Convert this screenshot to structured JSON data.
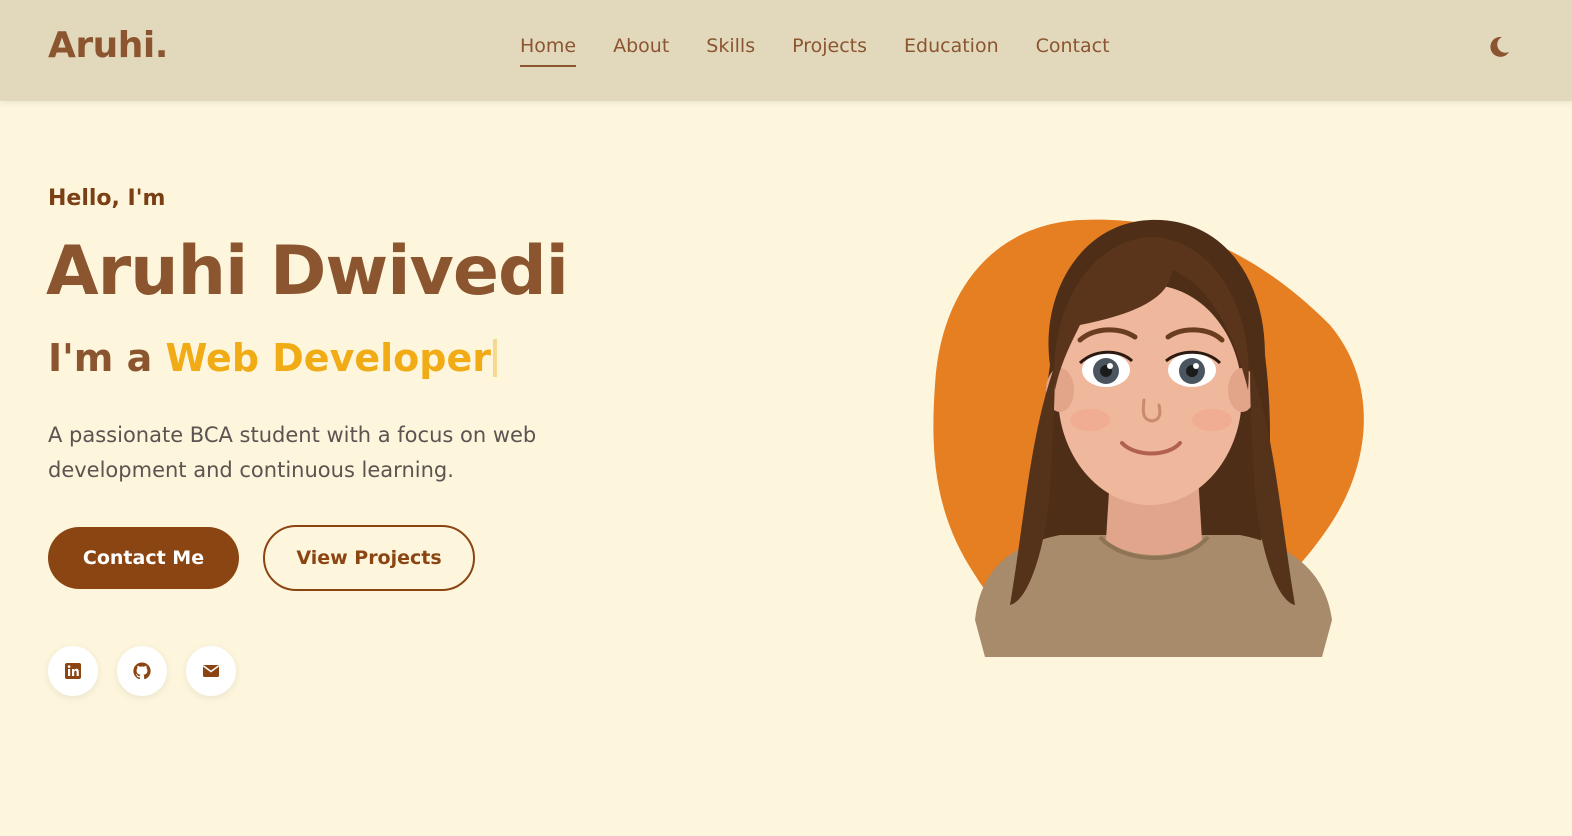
{
  "header": {
    "logo": "Aruhi.",
    "nav": [
      {
        "label": "Home",
        "active": true
      },
      {
        "label": "About",
        "active": false
      },
      {
        "label": "Skills",
        "active": false
      },
      {
        "label": "Projects",
        "active": false
      },
      {
        "label": "Education",
        "active": false
      },
      {
        "label": "Contact",
        "active": false
      }
    ],
    "theme_toggle_icon": "moon-icon"
  },
  "hero": {
    "greeting": "Hello, I'm",
    "name": "Aruhi Dwivedi",
    "role_prefix": "I'm a ",
    "role_text": "Web Developer",
    "description": "A passionate BCA student with a focus on web development and continuous learning.",
    "primary_button": "Contact Me",
    "secondary_button": "View Projects",
    "social_icons": [
      "linkedin-icon",
      "github-icon",
      "envelope-icon"
    ]
  },
  "colors": {
    "page_bg": "#fdf6dd",
    "header_bg": "#e2d9bd",
    "brand_brown": "#8b5530",
    "button_brown": "#8b4513",
    "accent_yellow": "#f1ab14",
    "blob_orange": "#e67e22"
  }
}
